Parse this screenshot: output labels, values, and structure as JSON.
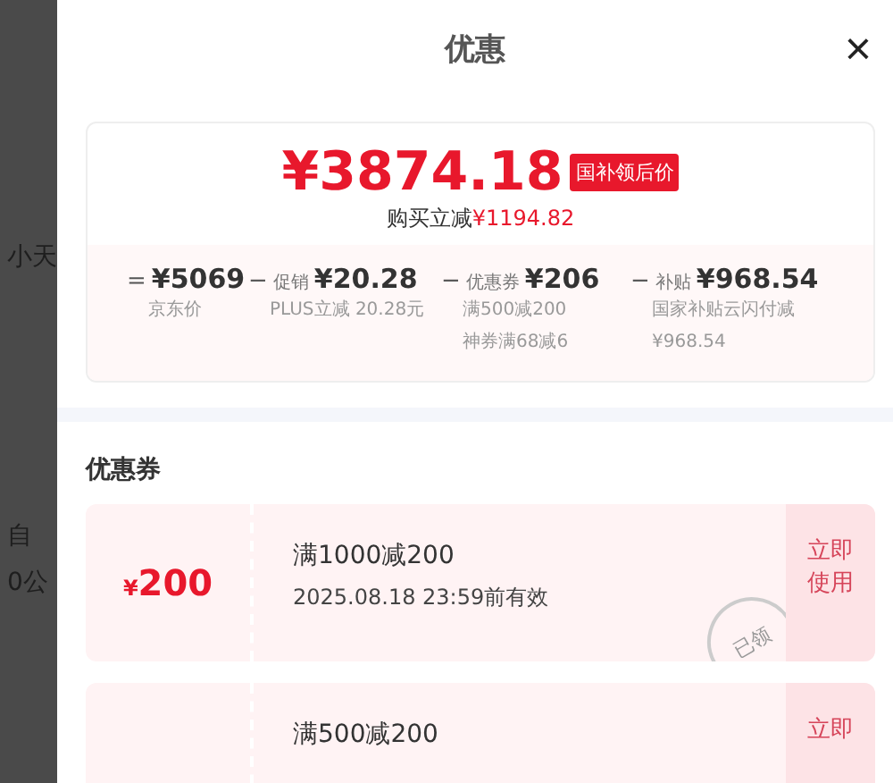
{
  "background": {
    "texts": [
      "小天",
      "自",
      "0公"
    ]
  },
  "sheet": {
    "title": "优惠",
    "close": "×"
  },
  "summary": {
    "price": "¥3874.18",
    "price_tag": "国补领后价",
    "saving_label": "购买立减",
    "saving": "¥1194.82",
    "items": [
      {
        "op": "=",
        "value": "¥5069",
        "notes": [
          "京东价"
        ]
      },
      {
        "op": "−",
        "label": "促销",
        "value": "¥20.28",
        "notes": [
          "PLUS立减 20.28元"
        ]
      },
      {
        "op": "−",
        "label": "优惠券",
        "value": "¥206",
        "notes": [
          "满500减200",
          "神券满68减6"
        ]
      },
      {
        "op": "−",
        "label": "补贴",
        "value": "¥968.54",
        "notes": [
          "国家补贴云闪付减¥968.54"
        ]
      }
    ]
  },
  "coupons_title": "优惠券",
  "coupons": [
    {
      "currency": "¥",
      "amount": "200",
      "title": "满1000减200",
      "validity": "2025.08.18 23:59前有效",
      "action": "立即使用",
      "stamp": "已领"
    },
    {
      "title": "满500减200",
      "action": "立即"
    }
  ]
}
